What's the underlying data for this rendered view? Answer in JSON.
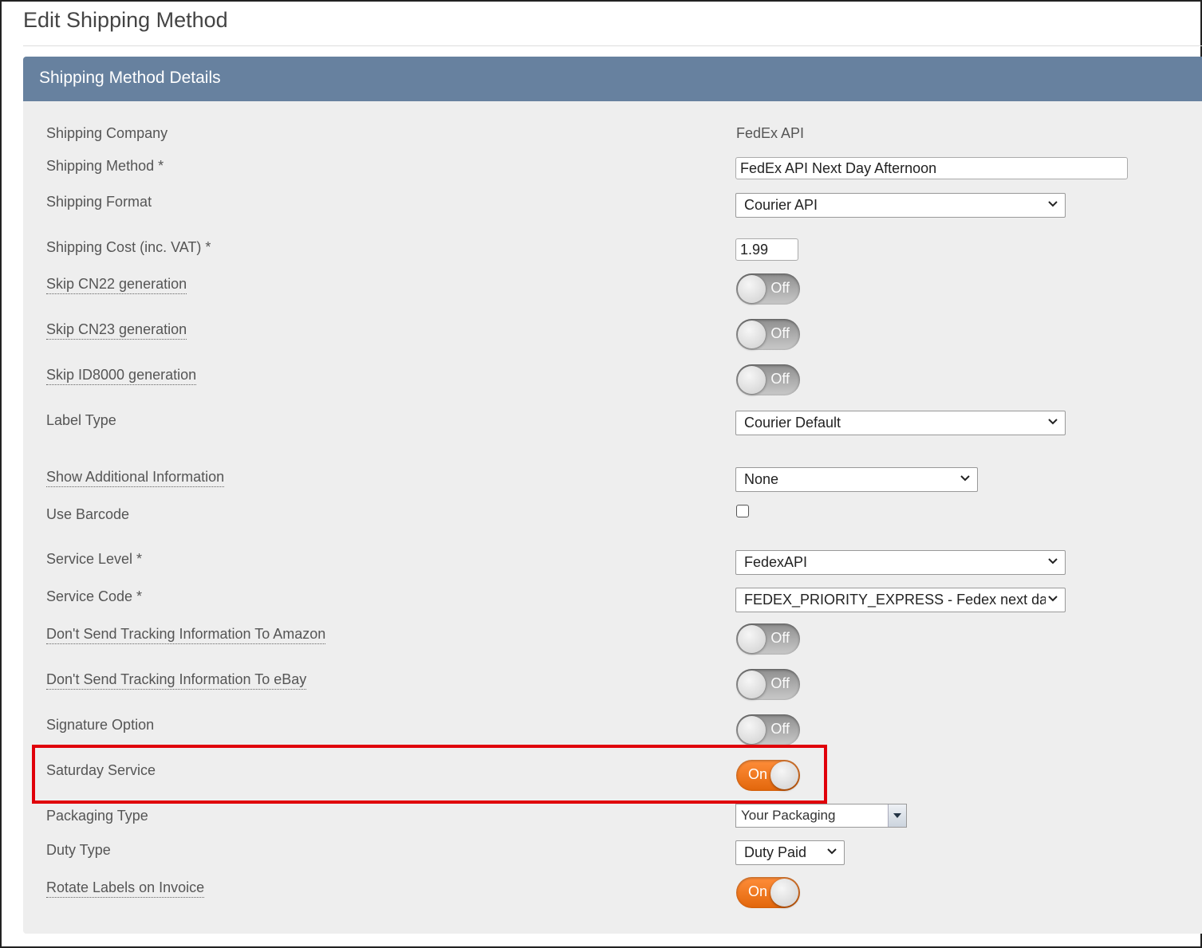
{
  "page": {
    "title": "Edit Shipping Method"
  },
  "panel": {
    "title": "Shipping Method Details"
  },
  "fields": {
    "shipping_company": {
      "label": "Shipping Company",
      "value": "FedEx API"
    },
    "shipping_method": {
      "label": "Shipping Method *",
      "value": "FedEx API Next Day Afternoon"
    },
    "shipping_format": {
      "label": "Shipping Format",
      "value": "Courier API"
    },
    "shipping_cost": {
      "label": "Shipping Cost (inc. VAT) *",
      "value": "1.99"
    },
    "skip_cn22": {
      "label": "Skip CN22 generation",
      "state": "Off"
    },
    "skip_cn23": {
      "label": "Skip CN23 generation",
      "state": "Off"
    },
    "skip_id8000": {
      "label": "Skip ID8000 generation",
      "state": "Off"
    },
    "label_type": {
      "label": "Label Type",
      "value": "Courier Default"
    },
    "show_additional": {
      "label": "Show Additional Information",
      "value": "None"
    },
    "use_barcode": {
      "label": "Use Barcode",
      "checked": false
    },
    "service_level": {
      "label": "Service Level *",
      "value": "FedexAPI"
    },
    "service_code": {
      "label": "Service Code *",
      "value": "FEDEX_PRIORITY_EXPRESS - Fedex next day afte"
    },
    "no_tracking_amazon": {
      "label": "Don't Send Tracking Information To Amazon",
      "state": "Off"
    },
    "no_tracking_ebay": {
      "label": "Don't Send Tracking Information To eBay",
      "state": "Off"
    },
    "signature_option": {
      "label": "Signature Option",
      "state": "Off"
    },
    "saturday_service": {
      "label": "Saturday Service",
      "state": "On"
    },
    "packaging_type": {
      "label": "Packaging Type",
      "value": "Your Packaging"
    },
    "duty_type": {
      "label": "Duty Type",
      "value": "Duty Paid"
    },
    "rotate_labels": {
      "label": "Rotate Labels on Invoice",
      "state": "On"
    }
  },
  "colors": {
    "panel_header": "#67819f",
    "toggle_on": "#f07a1e",
    "highlight_border": "#e0000a"
  },
  "icons": {
    "select": "chevron-down-icon",
    "combo": "triangle-down-icon"
  }
}
